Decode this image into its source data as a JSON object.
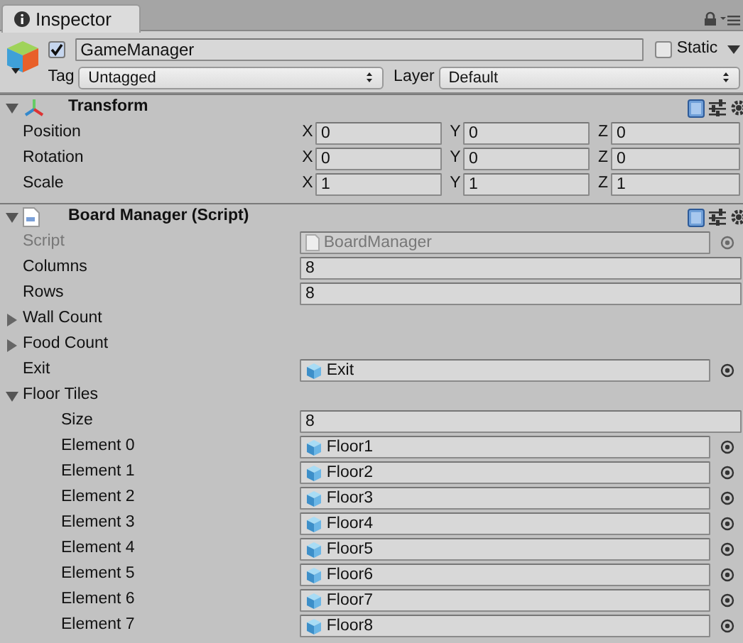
{
  "tab": {
    "title": "Inspector"
  },
  "header": {
    "active": true,
    "name": "GameManager",
    "static": false,
    "static_label": "Static",
    "tag_label": "Tag",
    "tag": "Untagged",
    "layer_label": "Layer",
    "layer": "Default"
  },
  "components": [
    {
      "title": "Transform",
      "kind": "transform",
      "expanded": true,
      "rows": [
        {
          "label": "Position",
          "values": [
            {
              "axis": "X",
              "value": "0"
            },
            {
              "axis": "Y",
              "value": "0"
            },
            {
              "axis": "Z",
              "value": "0"
            }
          ]
        },
        {
          "label": "Rotation",
          "values": [
            {
              "axis": "X",
              "value": "0"
            },
            {
              "axis": "Y",
              "value": "0"
            },
            {
              "axis": "Z",
              "value": "0"
            }
          ]
        },
        {
          "label": "Scale",
          "values": [
            {
              "axis": "X",
              "value": "1"
            },
            {
              "axis": "Y",
              "value": "1"
            },
            {
              "axis": "Z",
              "value": "1"
            }
          ]
        }
      ]
    },
    {
      "title": "Board Manager (Script)",
      "kind": "script",
      "expanded": true,
      "properties": [
        {
          "kind": "script",
          "label": "Script",
          "value": "BoardManager",
          "disabled": true
        },
        {
          "kind": "number",
          "label": "Columns",
          "value": "8"
        },
        {
          "kind": "number",
          "label": "Rows",
          "value": "8"
        },
        {
          "kind": "foldout",
          "label": "Wall Count",
          "expanded": false
        },
        {
          "kind": "foldout",
          "label": "Food Count",
          "expanded": false
        },
        {
          "kind": "object",
          "label": "Exit",
          "value": "Exit"
        },
        {
          "kind": "foldout",
          "label": "Floor Tiles",
          "expanded": true,
          "children": [
            {
              "kind": "number",
              "label": "Size",
              "value": "8"
            },
            {
              "kind": "object",
              "label": "Element 0",
              "value": "Floor1"
            },
            {
              "kind": "object",
              "label": "Element 1",
              "value": "Floor2"
            },
            {
              "kind": "object",
              "label": "Element 2",
              "value": "Floor3"
            },
            {
              "kind": "object",
              "label": "Element 3",
              "value": "Floor4"
            },
            {
              "kind": "object",
              "label": "Element 4",
              "value": "Floor5"
            },
            {
              "kind": "object",
              "label": "Element 5",
              "value": "Floor6"
            },
            {
              "kind": "object",
              "label": "Element 6",
              "value": "Floor7"
            },
            {
              "kind": "object",
              "label": "Element 7",
              "value": "Floor8"
            }
          ]
        }
      ]
    }
  ]
}
